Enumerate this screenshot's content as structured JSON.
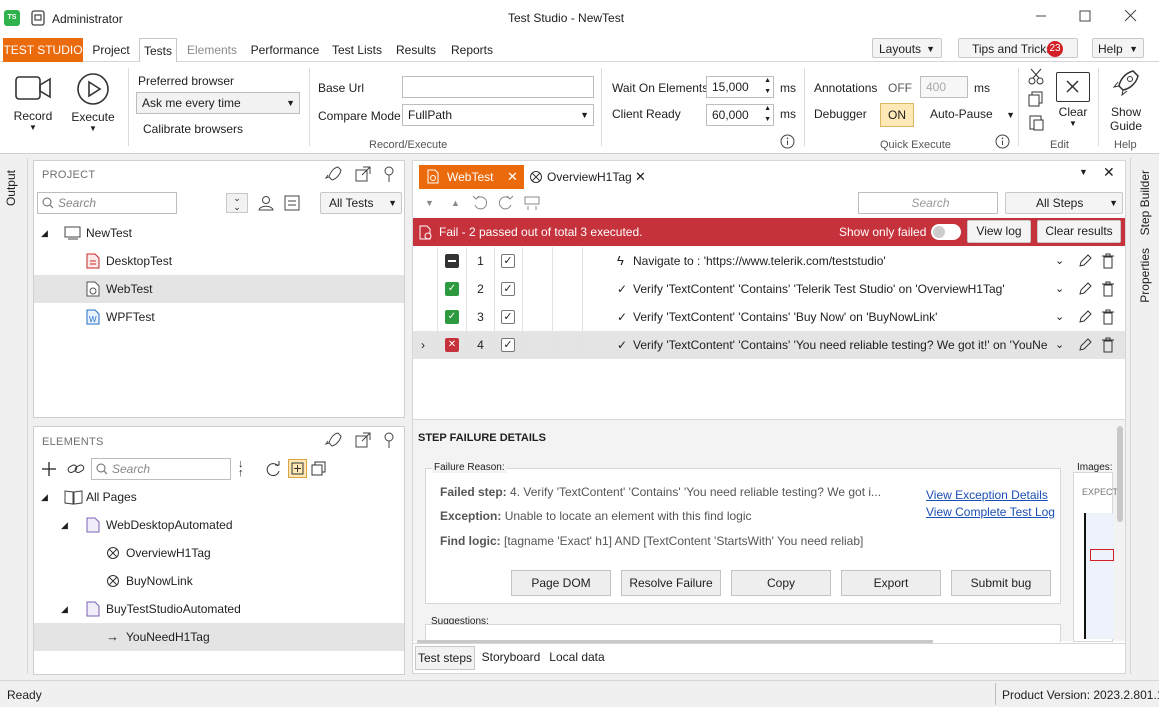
{
  "title_bar": {
    "user": "Administrator",
    "window_title": "Test Studio - NewTest",
    "app_badge": "TS"
  },
  "menu": {
    "brand": "TEST STUDIO",
    "tabs": [
      "Project",
      "Tests",
      "Elements",
      "Performance",
      "Test Lists",
      "Results",
      "Reports"
    ],
    "active_tab": "Tests",
    "layouts": "Layouts",
    "tips": "Tips and Tricks",
    "tips_count": "23",
    "help": "Help"
  },
  "ribbon": {
    "record": "Record",
    "execute": "Execute",
    "preferred_browser_label": "Preferred browser",
    "preferred_browser_value": "Ask me every time",
    "calibrate": "Calibrate browsers",
    "base_url_label": "Base Url",
    "base_url_value": "",
    "compare_mode_label": "Compare Mode",
    "compare_mode_value": "FullPath",
    "group_record_execute": "Record/Execute",
    "wait_label": "Wait On Elements",
    "wait_value": "15,000",
    "client_ready_label": "Client Ready",
    "client_ready_value": "60,000",
    "ms": "ms",
    "annotations_label": "Annotations",
    "annotations_state": "OFF",
    "annotations_value": "400",
    "debugger_label": "Debugger",
    "debugger_state": "ON",
    "auto_pause": "Auto-Pause",
    "group_quick_execute": "Quick Execute",
    "clear": "Clear",
    "group_edit": "Edit",
    "show_guide_1": "Show",
    "show_guide_2": "Guide",
    "group_help": "Help"
  },
  "side_left": {
    "output": "Output"
  },
  "side_right": {
    "step_builder": "Step Builder",
    "properties": "Properties"
  },
  "project_panel": {
    "header": "PROJECT",
    "search_placeholder": "Search",
    "filter": "All Tests",
    "tree": [
      {
        "label": "NewTest",
        "type": "project"
      },
      {
        "label": "DesktopTest",
        "type": "desktop-test"
      },
      {
        "label": "WebTest",
        "type": "web-test",
        "selected": true
      },
      {
        "label": "WPFTest",
        "type": "wpf-test"
      }
    ]
  },
  "elements_panel": {
    "header": "ELEMENTS",
    "search_placeholder": "Search",
    "tree": [
      {
        "label": "All Pages"
      },
      {
        "label": "WebDesktopAutomated"
      },
      {
        "label": "OverviewH1Tag"
      },
      {
        "label": "BuyNowLink"
      },
      {
        "label": "BuyTestStudioAutomated"
      },
      {
        "label": "YouNeedH1Tag",
        "selected": true
      }
    ]
  },
  "doc_tabs": [
    {
      "label": "WebTest",
      "active": true
    },
    {
      "label": "OverviewH1Tag",
      "active": false
    }
  ],
  "steps_toolbar": {
    "search_placeholder": "Search",
    "filter": "All Steps"
  },
  "result_bar": {
    "text": "Fail - 2 passed out of total 3 executed.",
    "show_only_failed": "Show only failed",
    "view_log": "View log",
    "clear_results": "Clear results"
  },
  "steps": [
    {
      "num": "1",
      "status": "none",
      "text": "Navigate to : 'https://www.telerik.com/teststudio'"
    },
    {
      "num": "2",
      "status": "pass",
      "text": "Verify 'TextContent' 'Contains' 'Telerik Test Studio' on 'OverviewH1Tag'"
    },
    {
      "num": "3",
      "status": "pass",
      "text": "Verify 'TextContent' 'Contains' 'Buy Now' on 'BuyNowLink'"
    },
    {
      "num": "4",
      "status": "fail",
      "text": "Verify 'TextContent' 'Contains' 'You need reliable testing? We got it!' on 'YouNe"
    }
  ],
  "failure": {
    "header": "STEP FAILURE DETAILS",
    "reason_label": "Failure Reason:",
    "failed_step_label": "Failed step:",
    "failed_step_value": "4. Verify 'TextContent' 'Contains' 'You need reliable testing? We got i...",
    "exception_label": "Exception:",
    "exception_value": "Unable to locate an element with this find logic",
    "find_logic_label": "Find logic:",
    "find_logic_value": "[tagname 'Exact' h1] AND [TextContent 'StartsWith' You need reliab]",
    "view_exception": "View Exception Details",
    "view_log": "View Complete Test Log",
    "buttons": [
      "Page DOM",
      "Resolve Failure",
      "Copy",
      "Export",
      "Submit bug"
    ],
    "images_label": "Images:",
    "expected_label": "EXPECT",
    "suggestions_label": "Suggestions:"
  },
  "bottom_tabs": [
    "Test steps",
    "Storyboard",
    "Local data"
  ],
  "status": {
    "left": "Ready",
    "version": "Product Version: 2023.2.801.1"
  }
}
